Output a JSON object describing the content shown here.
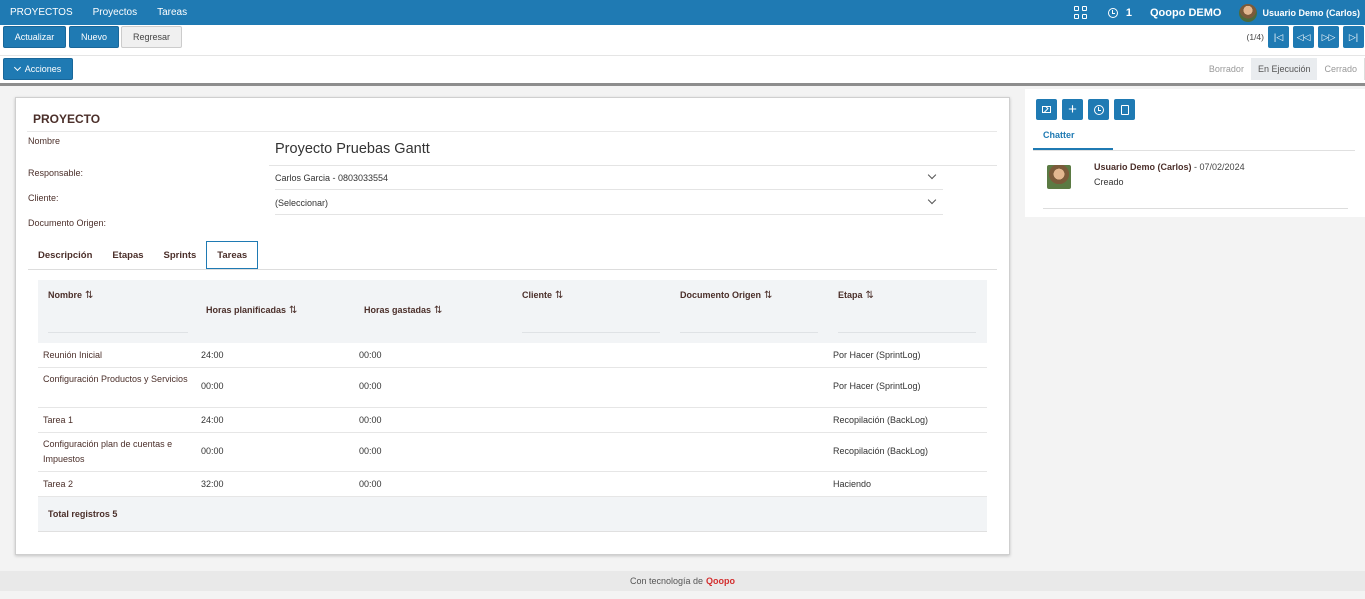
{
  "topbar": {
    "menu": [
      "PROYECTOS",
      "Proyectos",
      "Tareas"
    ],
    "activity_count": "1",
    "company": "Qoopo DEMO",
    "user": "Usuario Demo (Carlos)"
  },
  "toolbar": {
    "actualizar": "Actualizar",
    "nuevo": "Nuevo",
    "regresar": "Regresar",
    "pager": "(1/4)",
    "acciones": "Acciones"
  },
  "status_bar": {
    "stages": [
      "Borrador",
      "En Ejecución",
      "Cerrado"
    ],
    "active": "En Ejecución"
  },
  "form": {
    "title": "PROYECTO",
    "nombre_label": "Nombre",
    "nombre_value": "Proyecto Pruebas Gantt",
    "responsable_label": "Responsable:",
    "responsable_value": "Carlos Garcia - 0803033554",
    "cliente_label": "Cliente:",
    "cliente_value": "(Seleccionar)",
    "documento_label": "Documento Origen:"
  },
  "tabs": [
    "Descripción",
    "Etapas",
    "Sprints",
    "Tareas"
  ],
  "active_tab": "Tareas",
  "table": {
    "headers": [
      "Nombre",
      "Horas planificadas",
      "Horas gastadas",
      "Cliente",
      "Documento Origen",
      "Etapa"
    ],
    "sort_icon": "⇅",
    "rows": [
      {
        "nombre": "Reunión Inicial",
        "planificadas": "24:00",
        "gastadas": "00:00",
        "cliente": "",
        "documento": "",
        "etapa": "Por Hacer (SprintLog)"
      },
      {
        "nombre": "Configuración Productos y Servicios",
        "planificadas": "00:00",
        "gastadas": "00:00",
        "cliente": "",
        "documento": "",
        "etapa": "Por Hacer (SprintLog)"
      },
      {
        "nombre": "Tarea 1",
        "planificadas": "24:00",
        "gastadas": "00:00",
        "cliente": "",
        "documento": "",
        "etapa": "Recopilación (BackLog)"
      },
      {
        "nombre": "Configuración plan de cuentas e Impuestos",
        "planificadas": "00:00",
        "gastadas": "00:00",
        "cliente": "",
        "documento": "",
        "etapa": "Recopilación (BackLog)"
      },
      {
        "nombre": "Tarea 2",
        "planificadas": "32:00",
        "gastadas": "00:00",
        "cliente": "",
        "documento": "",
        "etapa": "Haciendo"
      }
    ],
    "total": "Total registros 5"
  },
  "chatter": {
    "tab": "Chatter",
    "message": {
      "author": "Usuario Demo (Carlos)",
      "date": " - 07/02/2024",
      "body": "Creado"
    }
  },
  "footer": {
    "text": "Con tecnología de",
    "brand": "Qoopo"
  },
  "colors": {
    "primary": "#1f7ab3",
    "brand": "#d32f2f",
    "label": "#4b2f2a"
  }
}
